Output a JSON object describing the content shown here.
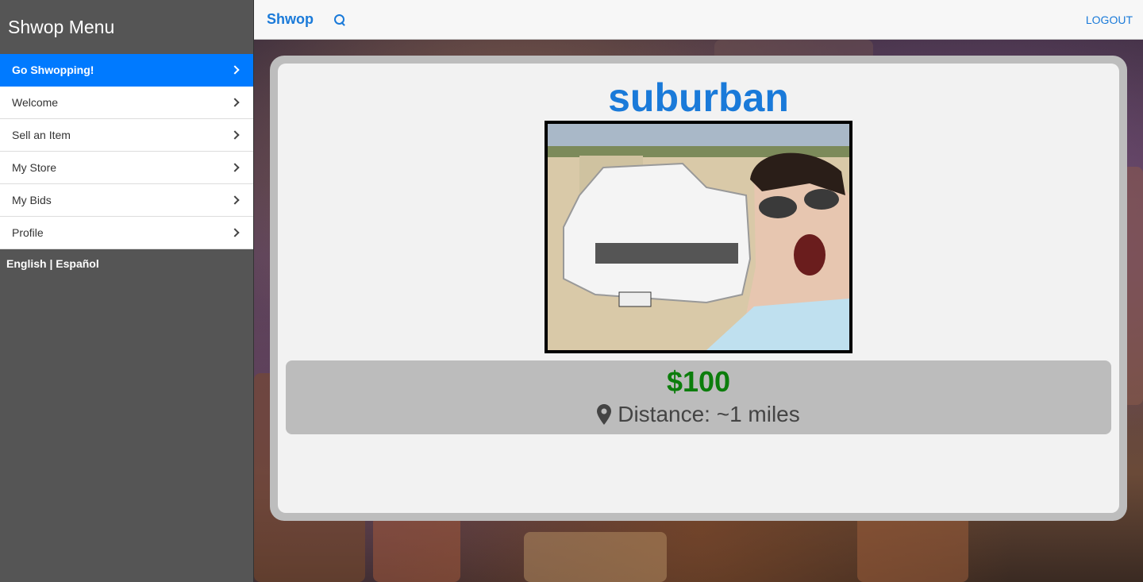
{
  "sidebar": {
    "title": "Shwop Menu",
    "items": [
      {
        "label": "Go Shwopping!",
        "active": true
      },
      {
        "label": "Welcome"
      },
      {
        "label": "Sell an Item"
      },
      {
        "label": "My Store"
      },
      {
        "label": "My Bids"
      },
      {
        "label": "Profile"
      }
    ],
    "lang_english": "English",
    "lang_separator": " | ",
    "lang_spanish": "Español"
  },
  "topbar": {
    "brand": "Shwop",
    "search_icon": "search-icon",
    "logout": "LOGOUT"
  },
  "listing": {
    "title": "suburban",
    "price": "$100",
    "distance": "Distance: ~1 miles",
    "distance_icon": "map-pin-icon"
  },
  "colors": {
    "accent": "#007aff",
    "price": "#0c7d0c",
    "sidebar_bg": "#555555"
  }
}
